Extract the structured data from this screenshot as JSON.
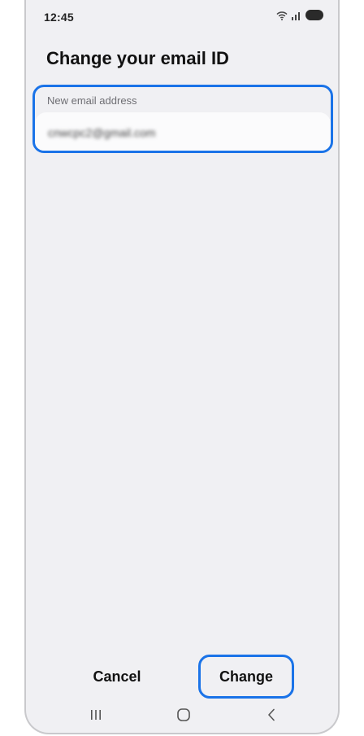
{
  "status_bar": {
    "time": "12:45",
    "icons": [
      "wifi-icon",
      "signal-icon",
      "battery-icon"
    ]
  },
  "page": {
    "title": "Change your email ID"
  },
  "email_field": {
    "label": "New email address",
    "value": "cnwcpc2@gmail.com"
  },
  "actions": {
    "cancel_label": "Cancel",
    "change_label": "Change"
  },
  "nav_bar": {
    "icons": [
      "recents-icon",
      "home-icon",
      "back-icon"
    ]
  },
  "colors": {
    "accent": "#1a73e8",
    "background": "#f0f0f3",
    "input_background": "#fbfbfc"
  }
}
